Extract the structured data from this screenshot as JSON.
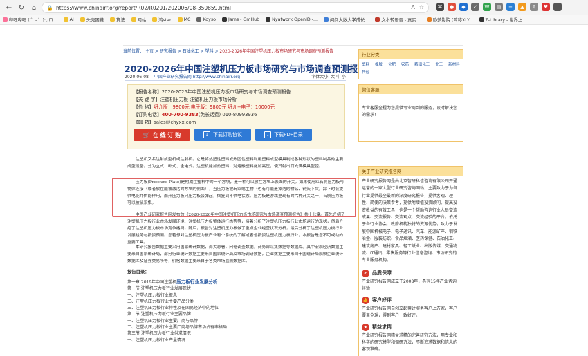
{
  "browser": {
    "url": "https://www.chinairr.org/report/R02/R0201/202006/08-350859.html",
    "bookmarks": [
      {
        "label": "哔哩哔哩 ( ゜- ゜)つロ...",
        "color": "#fb7299"
      },
      {
        "label": "AI",
        "color": "#f1c232"
      },
      {
        "label": "头壳困鞋",
        "color": "#f1c232"
      },
      {
        "label": "算法",
        "color": "#f1c232"
      },
      {
        "label": "网站",
        "color": "#f1c232"
      },
      {
        "label": "鸿star",
        "color": "#f1c232"
      },
      {
        "label": "MC",
        "color": "#f1c232"
      },
      {
        "label": "Koyso",
        "color": "#666666"
      },
      {
        "label": "Jams - GmHub",
        "color": "#333333"
      },
      {
        "label": "Nyatwork OpenID -...",
        "color": "#333333"
      },
      {
        "label": "问问大数大学成长...",
        "color": "#3f7fd8"
      },
      {
        "label": "文本转语音 - 真实...",
        "color": "#c0392b"
      },
      {
        "label": "欧萝影院 (简称XLY...",
        "color": "#e67e22"
      },
      {
        "label": "Z-Library - 世界上...",
        "color": "#333333"
      }
    ]
  },
  "page": {
    "breadcrumb": [
      "当前位置：",
      "主页",
      "研究报告",
      "石油化工",
      "塑料"
    ],
    "breadcrumb_current": "2020-2026年中国注塑机压力板市场研究与市场调查预测报告",
    "title": "2020-2026年中国注塑机压力板市场研究与市场调查预测报告",
    "date": "2020-06-08",
    "source": "中国产业研究报告网 http://www.chinairr.org",
    "font_size_label": "字体大小: 大 中 小",
    "info": {
      "name_label": "【报告名称】",
      "name_value": "2020-2026年中国注塑机压力板市场研究与市场调查预测报告",
      "keyword_label": "【关 键 字】",
      "keyword_value": "注塑机压力板 注塑机压力板市场分析",
      "price_label": "【价      格】",
      "price_value": "纸介版：9800元  电子版：9800元  纸介+电子：10000元",
      "phone_label": "【订购电话】",
      "phone_value_1": "400-700-9383",
      "phone_value_2": "(免长话费) 010-80993936",
      "email_label": "【邮      箱】",
      "email_value": "sales@chyxx.com"
    },
    "buttons": {
      "buy": "在 线 订 购",
      "download_agreement": "下载订购协议",
      "download_pdf": "下载PDF目录"
    },
    "paragraphs": {
      "p1": "注塑机又名注射成型机或注射机。它是将热塑性塑料或热固性塑料利用塑料成型模具制成各种形状的塑料制品的主要成型设备。分为立式、卧式、全电式。注塑机能加热塑料，对熔融塑料施加高压，使其射出而充满模具型腔。",
      "p2": "压力板(Pressure Plate)是构成注塑机中的一个方块，是一种可以放在方块上表面的开关。如果使用红石将压力板与物体连接（或者放在能被激活的方块的侧面），当压力板被玩家或生物（也有可能是掉落的物品、箭矢下文）踩下时会提供电能并供能作用，而开压力板只压力板会弹起，恢复到不供电状态。压力板是游戏里现有的六种开关之一，石质压力板可以被鼠采集。",
      "p3": "中国产业研究报告网发布的《2020-2026年中国注塑机压力板市场研究与市场调查预测报告》共十七章。首先介绍了注塑机压力板行业市场发展环境、注塑机压力板整体运行态势等，接着分析了注塑机压力板行业市场运行的现状，然后介绍了注塑机压力板市场竞争格局。随后，报告对注塑机压力板做了重点企业经营状况分析，最后分析了注塑机压力板行业发展趋势与投资预测。您若想对注塑机压力板产业有个系统的了解或者想投资注塑机压力板行业，本报告是您不可或缺的重要工具。",
      "p4": "本研究报告数据主要采用国家统计数据，海关总署，问卷调查数据，商务部采集数据等数据库。其中宏观经济数据主要来自国家统计局，部分行业统计数据主要来自国家统计局及市场调研数据，企业数据主要来自于国统计局规模企业统计数据库及证券交易所等，价格数据主要来自于各类市场监测数据库。"
    },
    "toc_title": "报告目录：",
    "toc_chapter_prefix": "第一章 2019年中国注塑机",
    "toc_chapter_hl": "压力板行业发展分析",
    "toc": [
      "第一节 注塑机压力板行业发展现状",
      "一、注塑机压力板行业概念",
      "二、注塑机压力板行业主要产品分类",
      "三、注塑机压力板行业特性及在国民经济中的地位",
      "第二节 注塑机压力板行业主要品牌",
      "一、注塑机压力板行业主要厂商与品牌",
      "二、注塑机压力板行业主要厂商与品牌市场占有率格局",
      "第三节 注塑机压力板行业供求情况",
      "一、注塑机压力板行业产量情况"
    ]
  },
  "sidebar": {
    "category_title": "行业分类",
    "categories": [
      "塑料",
      "橡胶",
      "化肥",
      "农药",
      "精细化工",
      "化工",
      "新材料",
      "其他"
    ],
    "service_title": "微信客服",
    "service_text": "专业客服全程为您提供专业周到的服务，及时解决您的需求！",
    "about_title": "关于产业研究报告网",
    "about_text": "产业研究报告网是由北京智研科信咨询有限公司开通运营的一家大型行业研究咨询网站，主要致力于为各行业提供最全最新的深度研究报告，提供客观、理性、简便的决策参考，提供附增值投资顾问。提高投资收益的有效工具，也是一个帮助咨询行业人员交流成果、交流报告、交流观点、交流经验的平台。依托于各行业协会、政府机构独特的资源优势，致力于发展中国机械电子、电子通讯、汽车、能源矿产、钢铁冶金、服装纺织、食品烟酒、医药保健、石油化工、建筑房产、建材家具、轻工纸业、出版传媒、交通物流、IT通讯、零售服务等行业信息咨询、市场研究的专业服务机构。",
    "guarantee_title": "品质保障",
    "guarantee_text": "产业研究报告网成立于2008年，具有15年产业咨询经验",
    "reputation_title": "客户好评",
    "reputation_text": "产业研究报告网自创立起累计服务客户上万家，客户覆盖全球，得到客户一致好评。",
    "precision_title": "精益求精",
    "precision_text": "产业研究报告网精益求精的完善研究方法，用专业和科学的研究模型和调研方法，不断追求数据和信息的客观准确。"
  }
}
